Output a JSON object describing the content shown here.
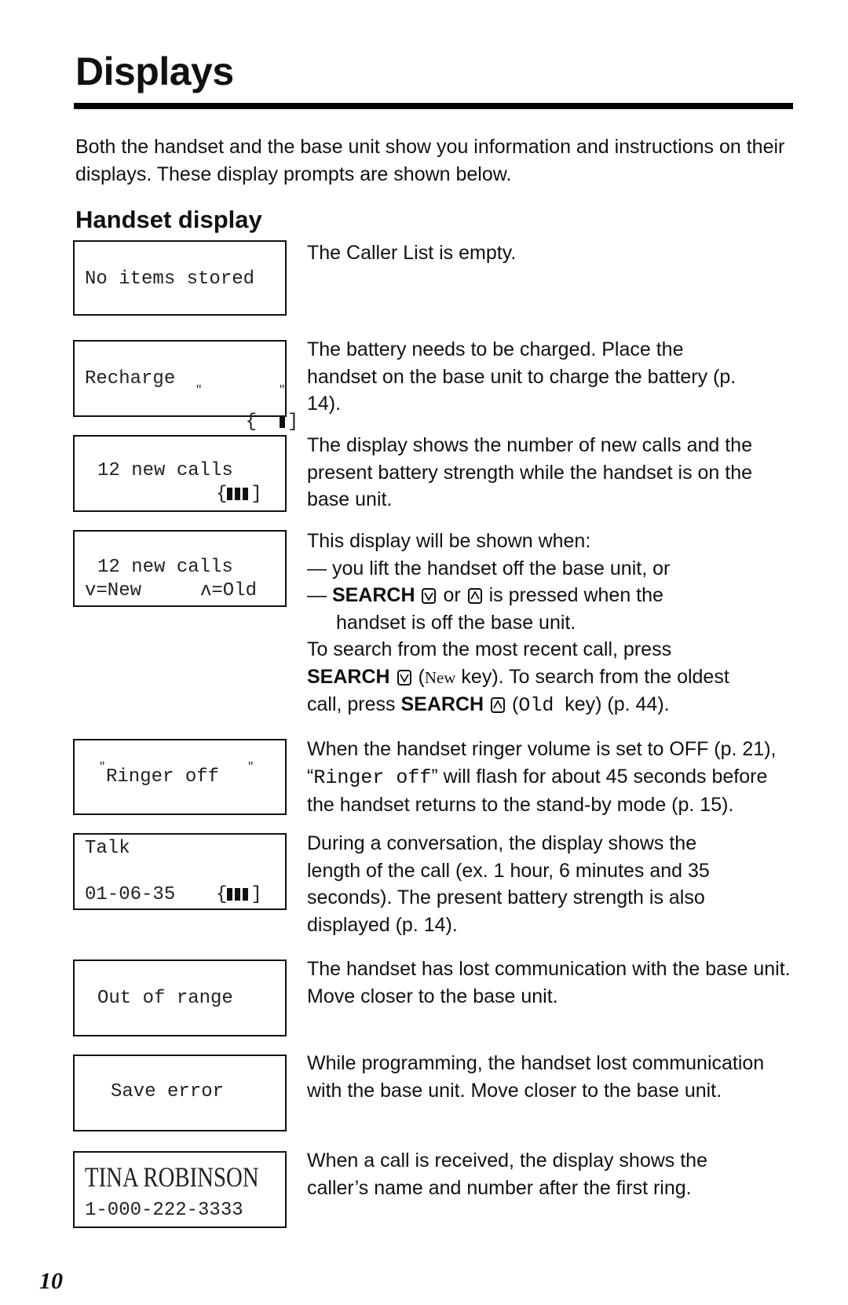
{
  "page": {
    "title": "Displays",
    "intro": "Both the handset and the base unit show you information and instructions on their displays. These display prompts are shown below.",
    "section_heading": "Handset display",
    "page_number": "10"
  },
  "displays": [
    {
      "lines": [
        "No items stored"
      ],
      "description": "The Caller List is empty."
    },
    {
      "lines": [
        "Recharge"
      ],
      "battery": {
        "bars_filled": 1,
        "bars_total": 3,
        "flashing": true
      },
      "description": "The battery needs to be charged. Place the handset on the base unit to charge the battery (p. 14)."
    },
    {
      "lines": [
        "12 new calls"
      ],
      "battery": {
        "bars_filled": 3,
        "bars_total": 3,
        "flashing": false
      },
      "description": "The display shows the number of new calls and the present battery strength while the handset is on the base unit."
    },
    {
      "lines": [
        "12 new calls",
        "v=New",
        "ʌ=Old"
      ],
      "description": {
        "line1": "This display will be shown when:",
        "bullet1": "you lift the handset off the base unit, or",
        "bullet2_key_label": "SEARCH",
        "bullet2_or": "or",
        "bullet2_rest": "is pressed when the",
        "bullet2_cont": "handset is off the base unit.",
        "para1": "To search from the most recent call, press",
        "para2_key_label": "SEARCH",
        "para2_new": "New",
        "para2_rest_a": "key). To search from the oldest",
        "para3_a": "call, press",
        "para3_key_label": "SEARCH",
        "para3_old": "Old",
        "para3_rest": "key) (p. 44).",
        "dash": "—",
        "open_paren": "("
      }
    },
    {
      "lines": [
        "Ringer off"
      ],
      "flashing": true,
      "description": {
        "line1": "When the handset ringer volume is set to OFF (p. 21),",
        "quote_mono": "Ringer off",
        "line2_rest": "will flash for about 45 seconds before",
        "line3": "the handset returns to the stand-by mode (p. 15).",
        "open_q": "“",
        "close_q": "”"
      }
    },
    {
      "lines": [
        "Talk",
        "01-06-35"
      ],
      "battery": {
        "bars_filled": 3,
        "bars_total": 3,
        "flashing": false
      },
      "description": "During a conversation, the display shows the length of the call (ex. 1 hour, 6 minutes and 35 seconds). The present battery strength is also displayed (p. 14)."
    },
    {
      "lines": [
        "Out of range"
      ],
      "description": "The handset has lost communication with the base unit. Move closer to the base unit."
    },
    {
      "lines": [
        "Save error"
      ],
      "description": "While programming, the handset lost communication with the base unit. Move closer to the base unit."
    },
    {
      "lines": [
        "TINA ROBINSON",
        "1-000-222-3333"
      ],
      "description": "When a call is received, the display shows the caller’s name and number after the first ring."
    }
  ]
}
